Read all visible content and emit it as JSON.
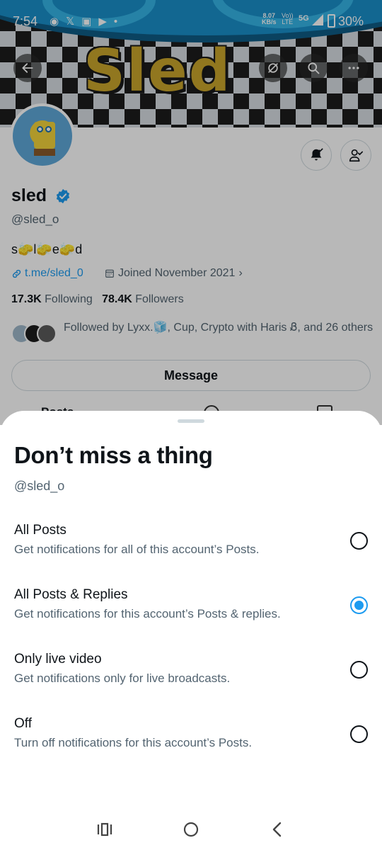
{
  "status_bar": {
    "time": "7:54",
    "net_speed_value": "8.07",
    "net_speed_unit": "KB/s",
    "volte_top": "Vo))",
    "volte_bottom": "LTE",
    "network": "5G",
    "battery": "30%"
  },
  "banner": {
    "title": "Sled"
  },
  "profile": {
    "name": "sled",
    "handle": "@sled_o",
    "bio": "s🧽l🧽e🧽d",
    "link": "t.me/sled_0",
    "joined": "Joined November 2021",
    "following_count": "17.3K",
    "following_label": "Following",
    "followers_count": "78.4K",
    "followers_label": "Followers",
    "followed_by": "Followed by Lyxx.🧊, Cup, Crypto with Haris Ᏸ, and 26 others",
    "message_label": "Message",
    "tab_posts": "Posts"
  },
  "sheet": {
    "title": "Don’t miss a thing",
    "handle": "@sled_o",
    "options": [
      {
        "title": "All Posts",
        "desc": "Get notifications for all of this account’s Posts.",
        "selected": false
      },
      {
        "title": "All Posts & Replies",
        "desc": "Get notifications for this account’s Posts & replies.",
        "selected": true
      },
      {
        "title": "Only live video",
        "desc": "Get notifications only for live broadcasts.",
        "selected": false
      },
      {
        "title": "Off",
        "desc": "Turn off notifications for this account’s Posts.",
        "selected": false
      }
    ]
  },
  "colors": {
    "accent": "#1d9bf0",
    "text_primary": "#0f1419",
    "text_secondary": "#536471",
    "banner_title": "#c9a52b"
  },
  "icons": {
    "back": "arrow-left-icon",
    "hide": "eye-slash-icon",
    "search": "search-icon",
    "more": "more-horizontal-icon",
    "notify": "bell-check-icon",
    "follow": "person-check-icon",
    "verified": "verified-badge-icon",
    "link": "link-icon",
    "calendar": "calendar-icon",
    "nav_recents": "recents-icon",
    "nav_home": "home-icon",
    "nav_back": "back-chevron-icon"
  }
}
